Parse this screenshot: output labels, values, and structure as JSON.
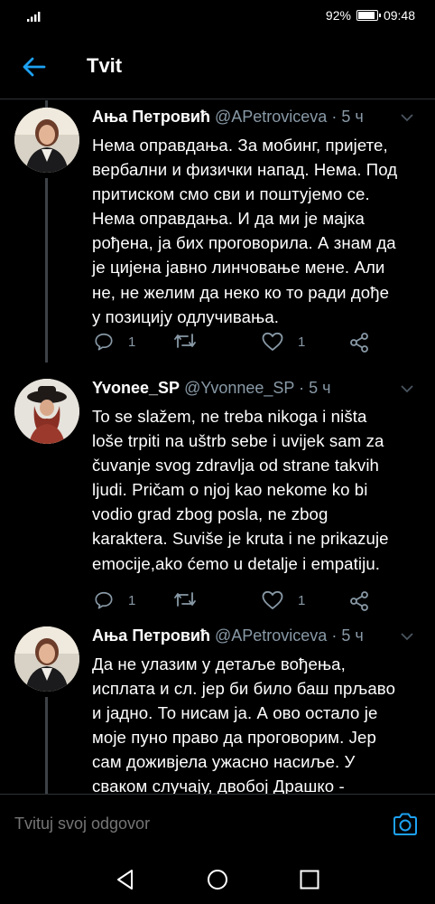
{
  "status": {
    "battery": "92%",
    "battery_level": 0.92,
    "time": "09:48"
  },
  "header": {
    "title": "Tvit"
  },
  "tweets": [
    {
      "name": "Ања Петровић",
      "handle": "@APetroviceva",
      "time": "· 5 ч",
      "text": "Нема оправдања. За мобинг, пријете,\nвербални и физички напад. Нема. Под\nпритиском смо сви и поштујемо се.\nНема оправдања. И да ми је мајка\nрођена, ја бих проговорила. А знам да\nје цијена јавно линчовање мене. Али\nне, не желим да неко ко то ради дође\nу позицију одлучивања.",
      "replies": "1",
      "likes": "1"
    },
    {
      "name": "Yvonee_SP",
      "handle": "@Yvonnee_SP",
      "time": "· 5 ч",
      "text": "To se slažem, ne treba nikoga i ništa\nloše trpiti na uštrb sebe i uvijek sam za\nčuvanje svog zdravlja od strane takvih\nljudi. Pričam o njoj kao nekome ko bi\nvodio grad zbog posla, ne  zbog\nkaraktera. Suviše je kruta i ne prikazuje\nemocije,ako ćemo u detalje i empatiju.",
      "replies": "1",
      "likes": "1"
    },
    {
      "name": "Ања Петровић",
      "handle": "@APetroviceva",
      "time": "· 5 ч",
      "text": "Да не улазим у детаље вођења,\nисплата и сл. јер би било баш прљаво\nи јадно. То нисам ја. А ово остало је\nмоје пуно право да проговорим. Јер\nсам доживјела ужасно насиље. У\nсваком случају, двобој Драшко -"
    }
  ],
  "reply": {
    "placeholder": "Tvituj svoj odgovor"
  },
  "colors": {
    "accent": "#1da1f2",
    "muted": "#8899a6",
    "background": "#000000"
  }
}
